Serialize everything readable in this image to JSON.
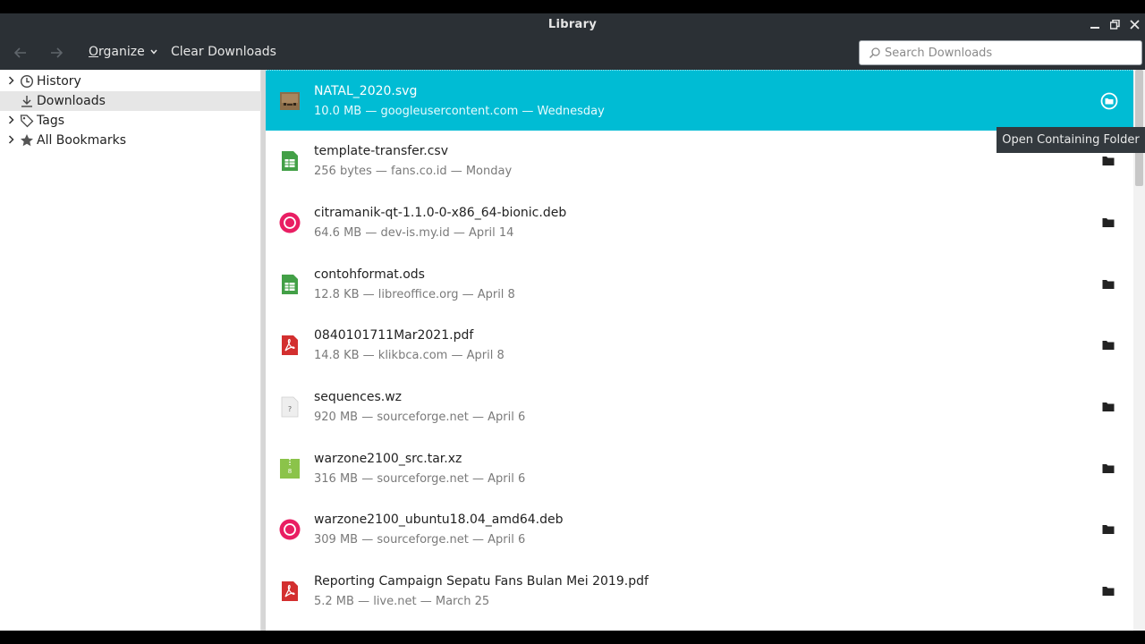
{
  "window": {
    "title": "Library"
  },
  "toolbar": {
    "back_icon": "arrow-left-icon",
    "forward_icon": "arrow-right-icon",
    "organize_label_underlined": "O",
    "organize_label_rest": "rganize",
    "clear_label": "Clear Downloads",
    "search_placeholder": "Search Downloads"
  },
  "sidebar": {
    "items": [
      {
        "label": "History",
        "icon": "clock-icon",
        "expandable": true
      },
      {
        "label": "Downloads",
        "icon": "download-icon",
        "expandable": false,
        "selected": true
      },
      {
        "label": "Tags",
        "icon": "tag-icon",
        "expandable": true
      },
      {
        "label": "All Bookmarks",
        "icon": "star-icon",
        "expandable": true
      }
    ]
  },
  "downloads": [
    {
      "name": "NATAL_2020.svg",
      "meta": "10.0 MB — googleusercontent.com — Wednesday",
      "type": "image",
      "selected": true
    },
    {
      "name": "template-transfer.csv",
      "meta": "256 bytes — fans.co.id — Monday",
      "type": "spreadsheet"
    },
    {
      "name": "citramanik-qt-1.1.0-0-x86_64-bionic.deb",
      "meta": "64.6 MB — dev-is.my.id — April 14",
      "type": "debian"
    },
    {
      "name": "contohformat.ods",
      "meta": "12.8 KB — libreoffice.org — April 8",
      "type": "spreadsheet"
    },
    {
      "name": "0840101711Mar2021.pdf",
      "meta": "14.8 KB — klikbca.com — April 8",
      "type": "pdf"
    },
    {
      "name": "sequences.wz",
      "meta": "920 MB — sourceforge.net — April 6",
      "type": "unknown"
    },
    {
      "name": "warzone2100_src.tar.xz",
      "meta": "316 MB — sourceforge.net — April 6",
      "type": "archive"
    },
    {
      "name": "warzone2100_ubuntu18.04_amd64.deb",
      "meta": "309 MB — sourceforge.net — April 6",
      "type": "debian"
    },
    {
      "name": "Reporting Campaign Sepatu Fans Bulan Mei 2019.pdf",
      "meta": "5.2 MB — live.net — March 25",
      "type": "pdf"
    }
  ],
  "tooltip": {
    "text": "Open Containing Folder"
  },
  "colors": {
    "selection": "#00bcd4",
    "titlebar": "#2b3035"
  }
}
